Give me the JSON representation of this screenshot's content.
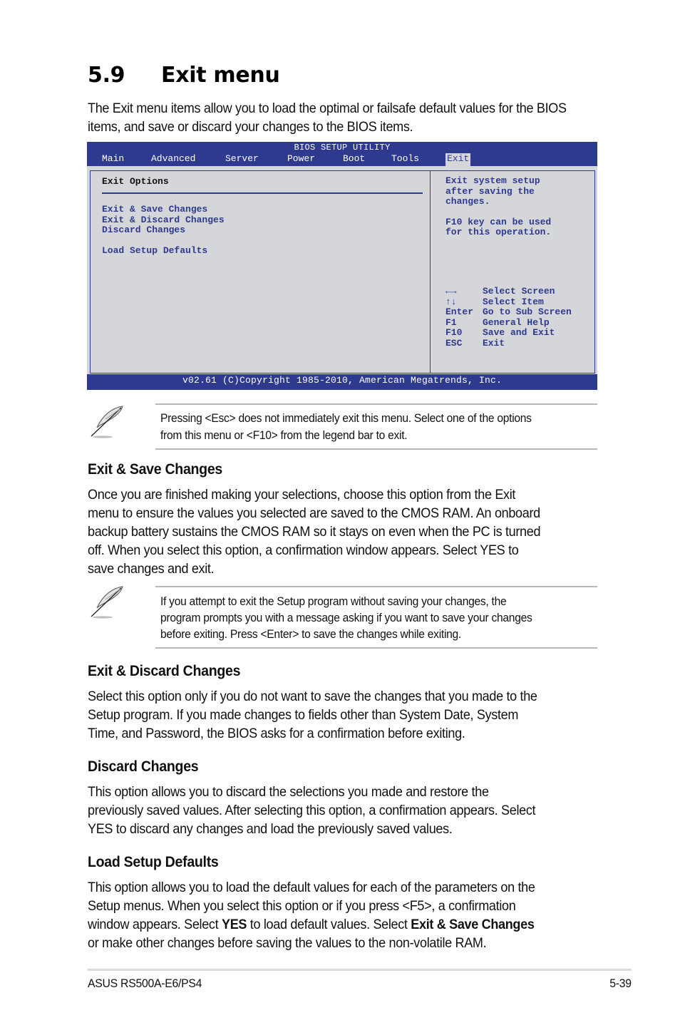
{
  "section": {
    "number": "5.9",
    "title": "Exit menu",
    "intro": "The Exit menu items allow you to load the optimal or failsafe default values for the BIOS items, and save or discard your changes to the BIOS items."
  },
  "bios": {
    "title": "BIOS SETUP UTILITY",
    "tabs": [
      {
        "label": "Main"
      },
      {
        "label": "Advanced"
      },
      {
        "label": "Server"
      },
      {
        "label": "Power"
      },
      {
        "label": "Boot"
      },
      {
        "label": "Tools"
      },
      {
        "label": "Exit",
        "active": true
      }
    ],
    "section_title": "Exit Options",
    "items": [
      {
        "label": "Exit & Save Changes"
      },
      {
        "label": "Exit & Discard Changes"
      },
      {
        "label": "Discard Changes"
      },
      {
        "label": "Load Setup Defaults"
      }
    ],
    "help_lines": [
      "Exit system setup",
      "after saving the",
      "changes.",
      "F10 key can be used",
      "for this operation."
    ],
    "legend": [
      {
        "key": "←→",
        "action": "Select Screen"
      },
      {
        "key": "↑↓",
        "action": "Select Item"
      },
      {
        "key": "Enter",
        "action": "Go to Sub Screen"
      },
      {
        "key": "F1",
        "action": "General Help"
      },
      {
        "key": "F10",
        "action": "Save and Exit"
      },
      {
        "key": "ESC",
        "action": "Exit"
      }
    ],
    "footer": "v02.61 (C)Copyright 1985-2010, American Megatrends, Inc.",
    "colors": {
      "header_bg": "#2e3a8e",
      "body_bg": "#d5d6d9",
      "text": "#2e3a8e"
    }
  },
  "notes": [
    {
      "icon": "feather-pen-icon",
      "lines": [
        "Pressing <Esc> does not immediately exit this menu. Select one of the options",
        "from this menu or <F10> from the legend bar to exit."
      ]
    },
    {
      "icon": "feather-pen-icon",
      "lines": [
        "If you attempt to exit the Setup program without saving your changes, the",
        "program prompts you with a message asking if you want to save your changes",
        "before exiting. Press <Enter> to save the changes while exiting."
      ]
    }
  ],
  "subsections": [
    {
      "heading": "Exit & Save Changes",
      "lines": [
        "Once you are finished making your selections, choose this option from the Exit",
        "menu to ensure the values you selected are saved to the CMOS RAM. An onboard",
        "backup battery sustains the CMOS RAM so it stays on even when the PC is turned",
        "off. When you select this option, a confirmation window appears. Select YES to",
        "save changes and exit."
      ]
    },
    {
      "heading": "Exit & Discard Changes",
      "lines": [
        "Select this option only if you do not want to save the changes that you made to the",
        "Setup program. If you made changes to fields other than System Date, System",
        "Time, and Password, the BIOS asks for a confirmation before exiting."
      ]
    },
    {
      "heading": "Discard Changes",
      "lines": [
        "This option allows you to discard the selections you made and restore the",
        "previously saved values. After selecting this option, a confirmation appears. Select",
        "YES to discard any changes and load the previously saved values."
      ]
    },
    {
      "heading": "Load Setup Defaults",
      "line1": "This option allows you to load the default values for each of the parameters on the",
      "line2": "Setup menus. When you select this option or if you press <F5>, a confirmation",
      "line3_a": "window appears. Select ",
      "line3_b": "YES",
      "line3_c": " to load default values. Select ",
      "line3_d": "Exit & Save Changes",
      "line4": "or make other changes before saving the values to the non-volatile RAM."
    }
  ],
  "footer": {
    "product": "ASUS RS500A-E6/PS4",
    "page": "5-39"
  }
}
